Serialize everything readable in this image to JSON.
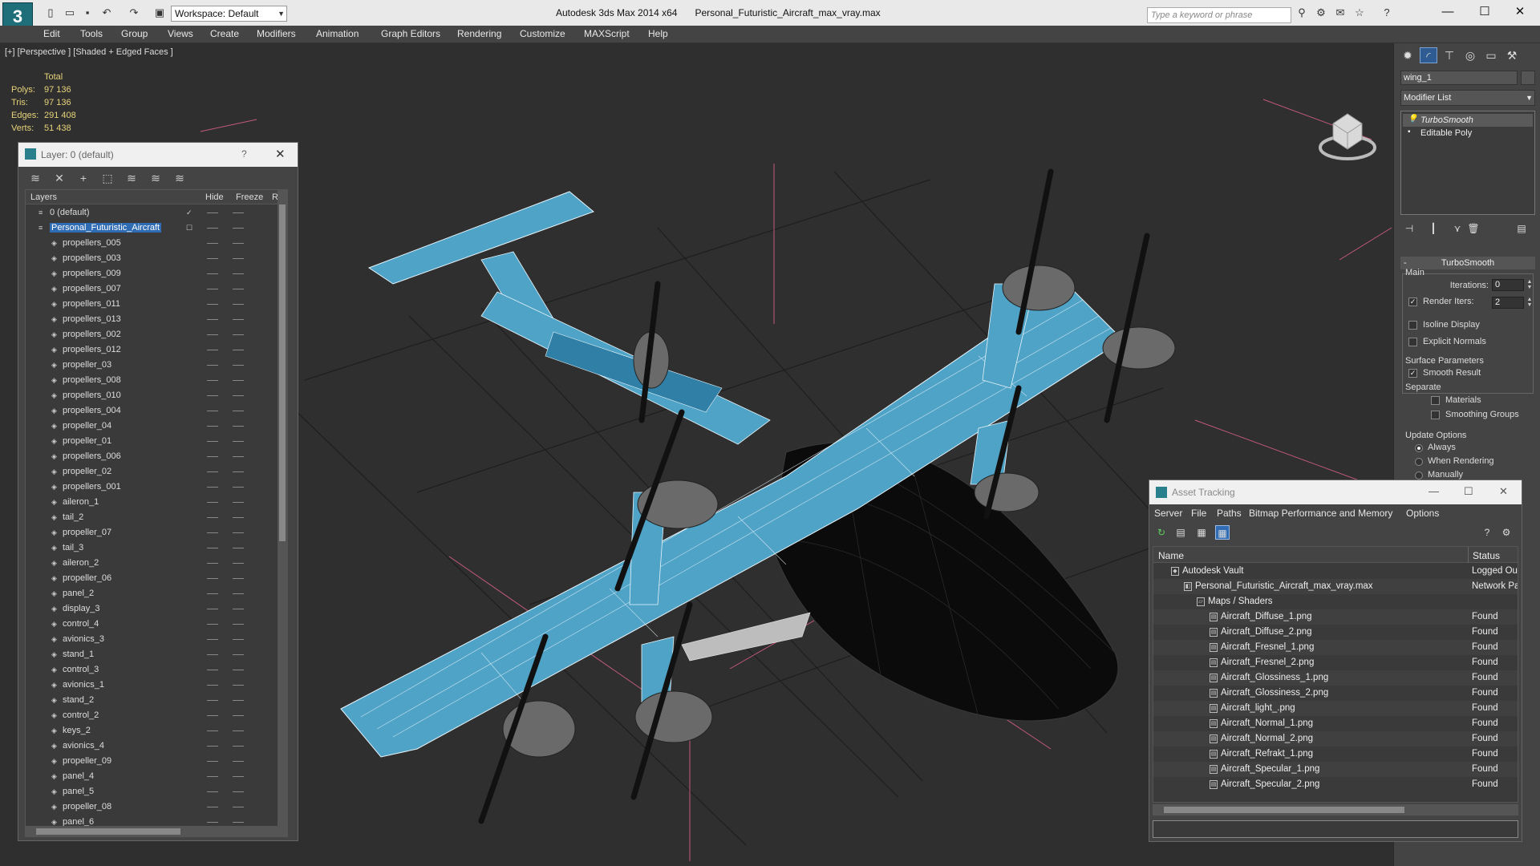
{
  "window": {
    "app_title": "Autodesk 3ds Max  2014 x64",
    "file_title": "Personal_Futuristic_Aircraft_max_vray.max",
    "search_placeholder": "Type a keyword or phrase",
    "workspace": "Workspace: Default",
    "minimize": "—",
    "maximize": "☐",
    "close": "✕"
  },
  "menu": [
    "Edit",
    "Tools",
    "Group",
    "Views",
    "Create",
    "Modifiers",
    "Animation",
    "Graph Editors",
    "Rendering",
    "Customize",
    "MAXScript",
    "Help"
  ],
  "viewport": {
    "label": "[+] [Perspective ] [Shaded + Edged Faces ]",
    "stats": {
      "header": "Total",
      "rows": [
        {
          "k": "Polys:",
          "v": "97 136"
        },
        {
          "k": "Tris:",
          "v": "97 136"
        },
        {
          "k": "Edges:",
          "v": "291 408"
        },
        {
          "k": "Verts:",
          "v": "51 438"
        }
      ]
    }
  },
  "layer_window": {
    "title": "Layer: 0 (default)",
    "help": "?",
    "close": "✕",
    "columns": {
      "layers": "Layers",
      "hide": "Hide",
      "freeze": "Freeze",
      "render": "R"
    },
    "layers": [
      "0 (default)",
      "Personal_Futuristic_Aircraft",
      "propellers_005",
      "propellers_003",
      "propellers_009",
      "propellers_007",
      "propellers_011",
      "propellers_013",
      "propellers_002",
      "propellers_012",
      "propeller_03",
      "propellers_008",
      "propellers_010",
      "propellers_004",
      "propeller_04",
      "propeller_01",
      "propellers_006",
      "propeller_02",
      "propellers_001",
      "aileron_1",
      "tail_2",
      "propeller_07",
      "tail_3",
      "aileron_2",
      "propeller_06",
      "panel_2",
      "display_3",
      "control_4",
      "avionics_3",
      "stand_1",
      "control_3",
      "avionics_1",
      "stand_2",
      "control_2",
      "keys_2",
      "avionics_4",
      "propeller_09",
      "panel_4",
      "panel_5",
      "propeller_08",
      "panel_6"
    ]
  },
  "command_panel": {
    "object_name": "wing_1",
    "modifier_list": "Modifier List",
    "stack": [
      "TurboSmooth",
      "Editable Poly"
    ],
    "turbosmooth": {
      "title": "TurboSmooth",
      "main": "Main",
      "iterations_label": "Iterations:",
      "iterations": "0",
      "render_iters_label": "Render Iters:",
      "render_iters": "2",
      "render_iters_checked": true,
      "isoline": "Isoline Display",
      "explicit_normals": "Explicit Normals",
      "surface_params": "Surface Parameters",
      "smooth_result": "Smooth Result",
      "separate": "Separate",
      "materials": "Materials",
      "smoothing_groups": "Smoothing Groups",
      "update_options": "Update Options",
      "always": "Always",
      "when_rendering": "When Rendering",
      "manually": "Manually"
    }
  },
  "asset_tracking": {
    "title": "Asset Tracking",
    "menu": [
      "Server",
      "File",
      "Paths",
      "Bitmap Performance and Memory",
      "Options"
    ],
    "columns": {
      "name": "Name",
      "status": "Status"
    },
    "rows": [
      {
        "name": "Autodesk Vault",
        "status": "Logged Out",
        "level": 0
      },
      {
        "name": "Personal_Futuristic_Aircraft_max_vray.max",
        "status": "Network Path",
        "level": 1
      },
      {
        "name": "Maps / Shaders",
        "status": "",
        "level": 2
      },
      {
        "name": "Aircraft_Diffuse_1.png",
        "status": "Found",
        "level": 3
      },
      {
        "name": "Aircraft_Diffuse_2.png",
        "status": "Found",
        "level": 3
      },
      {
        "name": "Aircraft_Fresnel_1.png",
        "status": "Found",
        "level": 3
      },
      {
        "name": "Aircraft_Fresnel_2.png",
        "status": "Found",
        "level": 3
      },
      {
        "name": "Aircraft_Glossiness_1.png",
        "status": "Found",
        "level": 3
      },
      {
        "name": "Aircraft_Glossiness_2.png",
        "status": "Found",
        "level": 3
      },
      {
        "name": "Aircraft_light_.png",
        "status": "Found",
        "level": 3
      },
      {
        "name": "Aircraft_Normal_1.png",
        "status": "Found",
        "level": 3
      },
      {
        "name": "Aircraft_Normal_2.png",
        "status": "Found",
        "level": 3
      },
      {
        "name": "Aircraft_Refrakt_1.png",
        "status": "Found",
        "level": 3
      },
      {
        "name": "Aircraft_Specular_1.png",
        "status": "Found",
        "level": 3
      },
      {
        "name": "Aircraft_Specular_2.png",
        "status": "Found",
        "level": 3
      }
    ]
  },
  "colors": {
    "wing_blue": "#4fa3c7",
    "viewport_bg": "#2f2f2f",
    "selection": "#2f6cb3",
    "stats_yellow": "#e8d37a"
  }
}
